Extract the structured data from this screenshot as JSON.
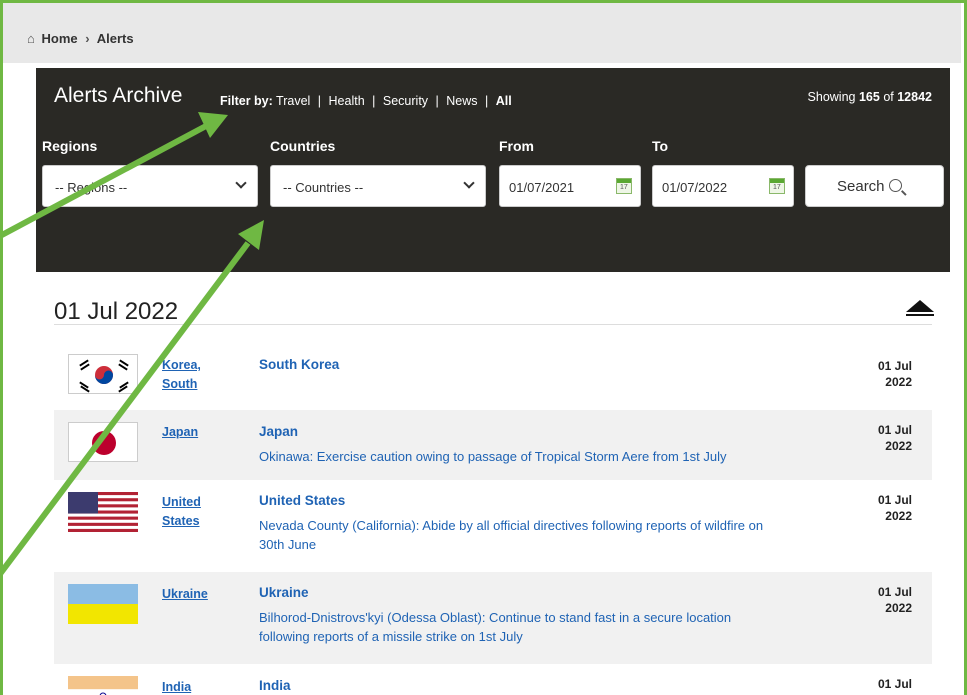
{
  "breadcrumb": {
    "home": "Home",
    "sep": "›",
    "current": "Alerts"
  },
  "archive": {
    "title": "Alerts Archive",
    "filter_label": "Filter by:",
    "filters": [
      "Travel",
      "Health",
      "Security",
      "News",
      "All"
    ],
    "filter_separator": "|",
    "active_filter": "All",
    "showing_prefix": "Showing",
    "showing_count": "165",
    "showing_of": "of",
    "showing_total": "12842"
  },
  "form": {
    "regions_label": "Regions",
    "regions_value": "-- Regions --",
    "countries_label": "Countries",
    "countries_value": "-- Countries --",
    "from_label": "From",
    "from_value": "01/07/2021",
    "to_label": "To",
    "to_value": "01/07/2022",
    "calendar_text": "17",
    "search_label": "Search"
  },
  "group": {
    "date": "01 Jul 2022",
    "alerts": [
      {
        "country_line1": "Korea,",
        "country_line2": "South",
        "headline": "South Korea",
        "detail_lines": [],
        "date_line1": "01 Jul",
        "date_line2": "2022",
        "flag": "south-korea-flag"
      },
      {
        "country_line1": "Japan",
        "country_line2": "",
        "headline": "Japan",
        "detail_lines": [
          "Okinawa: Exercise caution owing to passage of Tropical Storm Aere from 1st July"
        ],
        "date_line1": "01 Jul",
        "date_line2": "2022",
        "flag": "japan-flag"
      },
      {
        "country_line1": "United",
        "country_line2": "States",
        "headline": "United States",
        "detail_lines": [
          "Nevada County (California): Abide by all official directives following reports of wildfire on",
          "30th June"
        ],
        "date_line1": "01 Jul",
        "date_line2": "2022",
        "flag": "usa-flag"
      },
      {
        "country_line1": "Ukraine",
        "country_line2": "",
        "headline": "Ukraine",
        "detail_lines": [
          "Bilhorod-Dnistrovs'kyi (Odessa Oblast): Continue to stand fast in a secure location",
          "following reports of a missile strike on 1st July"
        ],
        "date_line1": "01 Jul",
        "date_line2": "2022",
        "flag": "ukraine-flag"
      },
      {
        "country_line1": "India",
        "country_line2": "",
        "headline": "India",
        "detail_lines": [],
        "date_line1": "01 Jul",
        "date_line2": "",
        "flag": "india-flag"
      }
    ]
  },
  "colors": {
    "frame_green": "#6fb843",
    "dark_panel": "#2a2925",
    "link_blue": "#1f63b4",
    "row_alt": "#f1f1f1"
  }
}
